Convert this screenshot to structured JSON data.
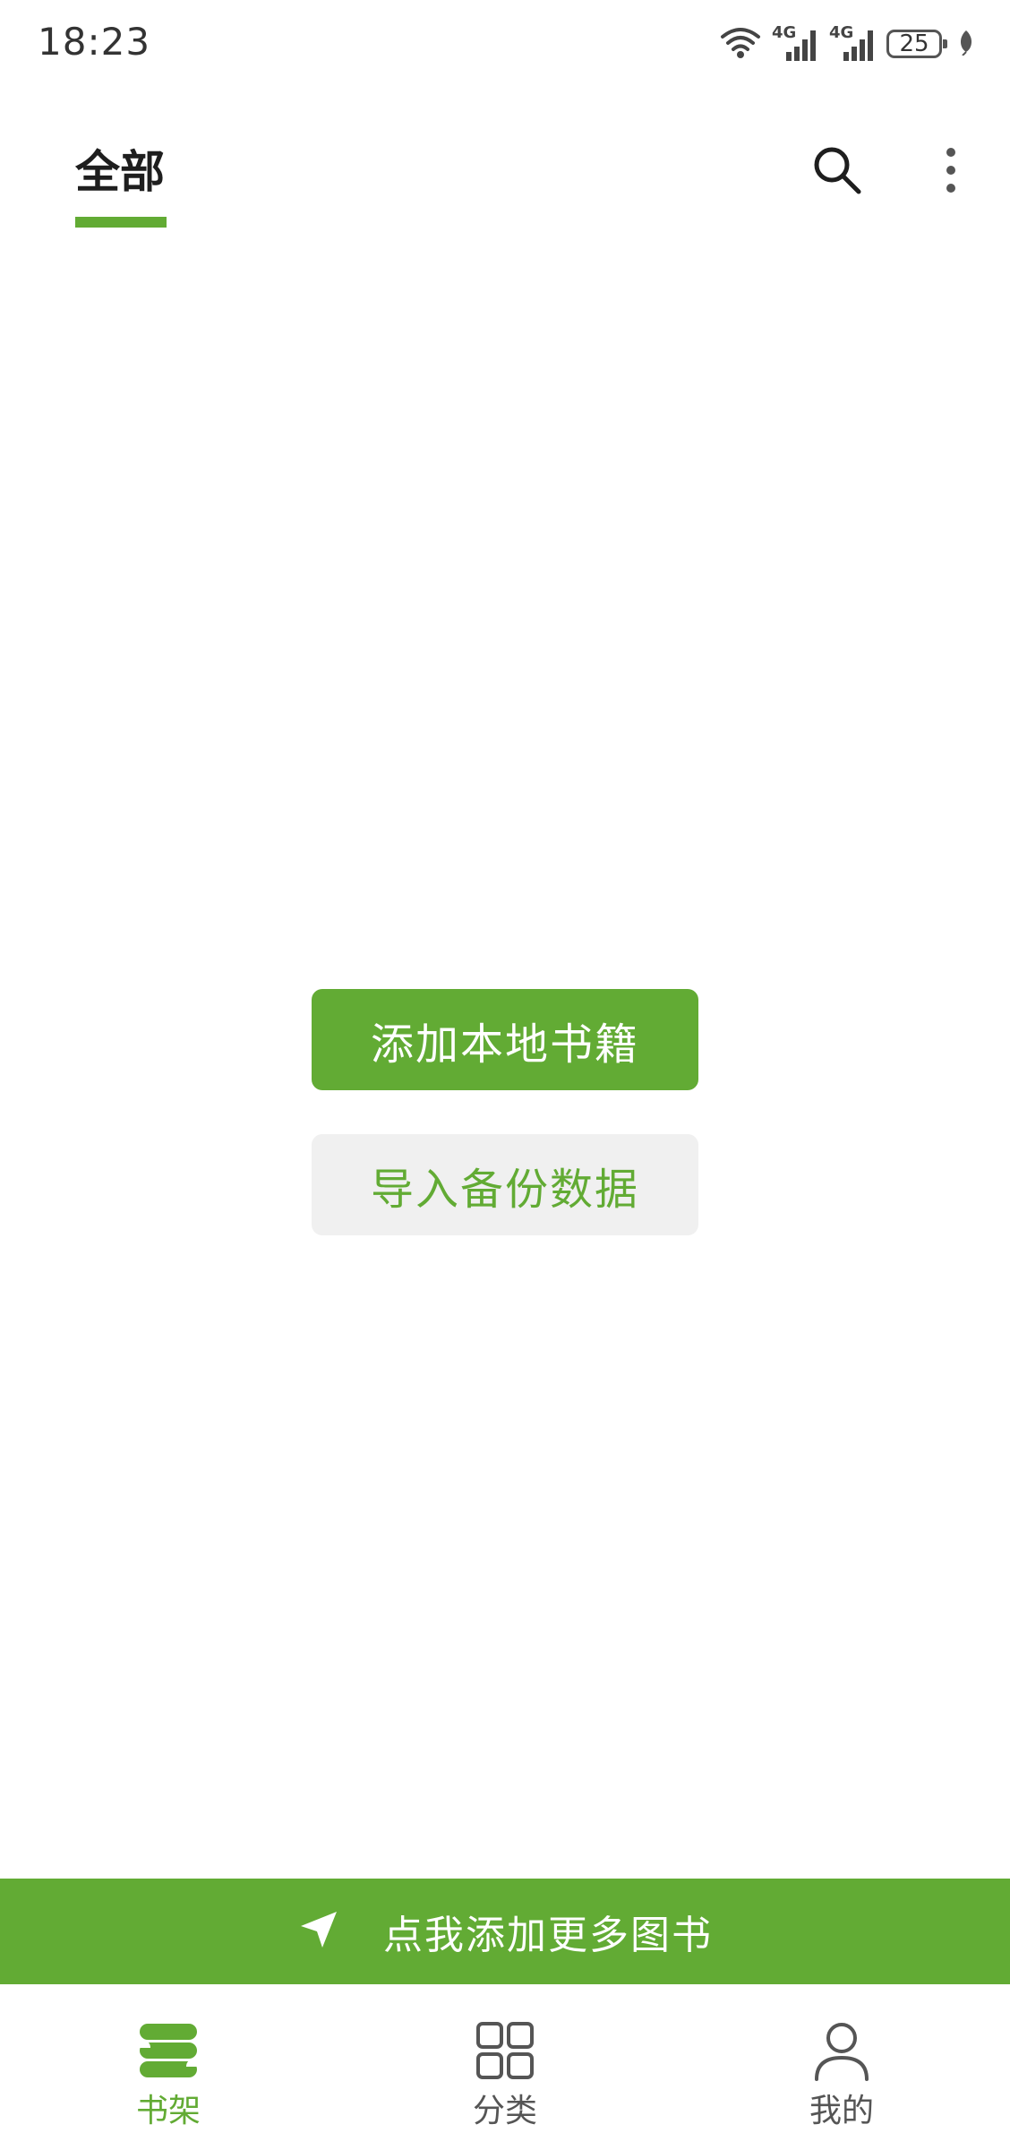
{
  "status_bar": {
    "time": "18:23",
    "network_1": "4G",
    "network_2": "4G",
    "battery": "25",
    "icons": [
      "wifi-icon",
      "signal-icon",
      "signal-icon",
      "battery-icon",
      "leaf-icon"
    ]
  },
  "top_bar": {
    "tab_label": "全部",
    "icons": [
      "search-icon",
      "more-vertical-icon"
    ]
  },
  "main": {
    "add_local_books": "添加本地书籍",
    "import_backup": "导入备份数据"
  },
  "promo_banner": {
    "text": "点我添加更多图书",
    "icon": "navigation-arrow-icon"
  },
  "bottom_nav": {
    "items": [
      {
        "label": "书架",
        "icon": "bookshelf-icon",
        "active": true
      },
      {
        "label": "分类",
        "icon": "category-grid-icon",
        "active": false
      },
      {
        "label": "我的",
        "icon": "profile-icon",
        "active": false
      }
    ]
  },
  "colors": {
    "accent": "#62ab34",
    "secondary_bg": "#f0f0f0",
    "text_dark": "#1e1e1e",
    "text_gray": "#555555"
  }
}
